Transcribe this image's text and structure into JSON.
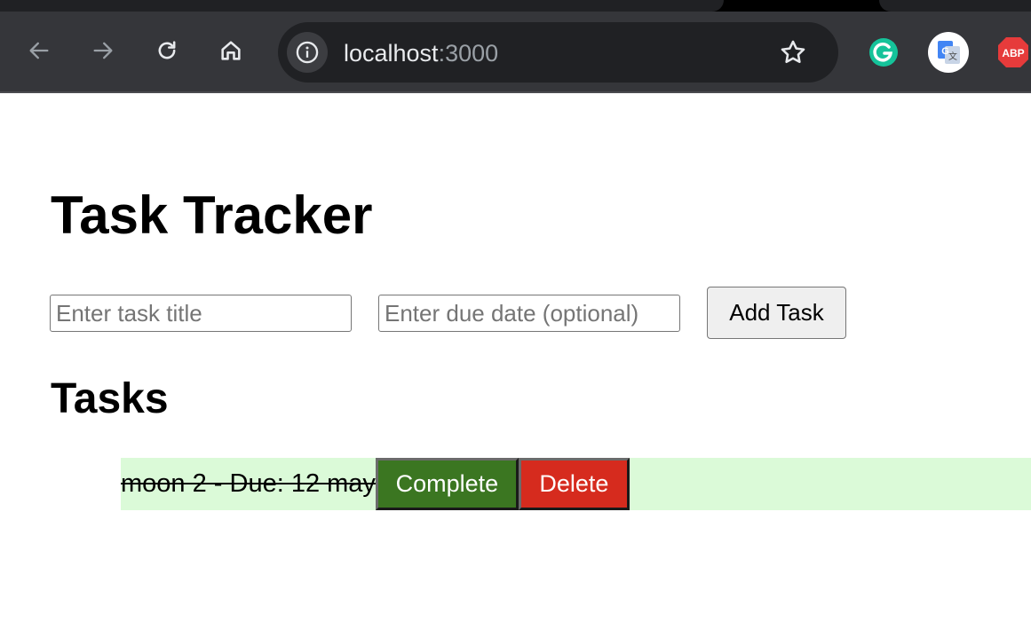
{
  "browser": {
    "url_host": "localhost",
    "url_port": ":3000",
    "nav_icons": [
      "back-arrow-icon",
      "forward-arrow-icon",
      "reload-icon",
      "home-icon"
    ],
    "extensions": [
      "grammarly-icon",
      "google-translate-icon",
      "adblock-plus-icon"
    ],
    "abp_label": "ABP"
  },
  "app": {
    "title": "Task Tracker",
    "form": {
      "title_placeholder": "Enter task title",
      "date_placeholder": "Enter due date (optional)",
      "add_button": "Add Task"
    },
    "tasks_heading": "Tasks",
    "tasks": [
      {
        "text": "moon 2 - Due: 12 may",
        "completed": true,
        "complete_label": "Complete",
        "delete_label": "Delete"
      }
    ]
  },
  "colors": {
    "completed_row": "#dbfad8",
    "complete_button": "#3b7621",
    "delete_button": "#d62b1e"
  }
}
